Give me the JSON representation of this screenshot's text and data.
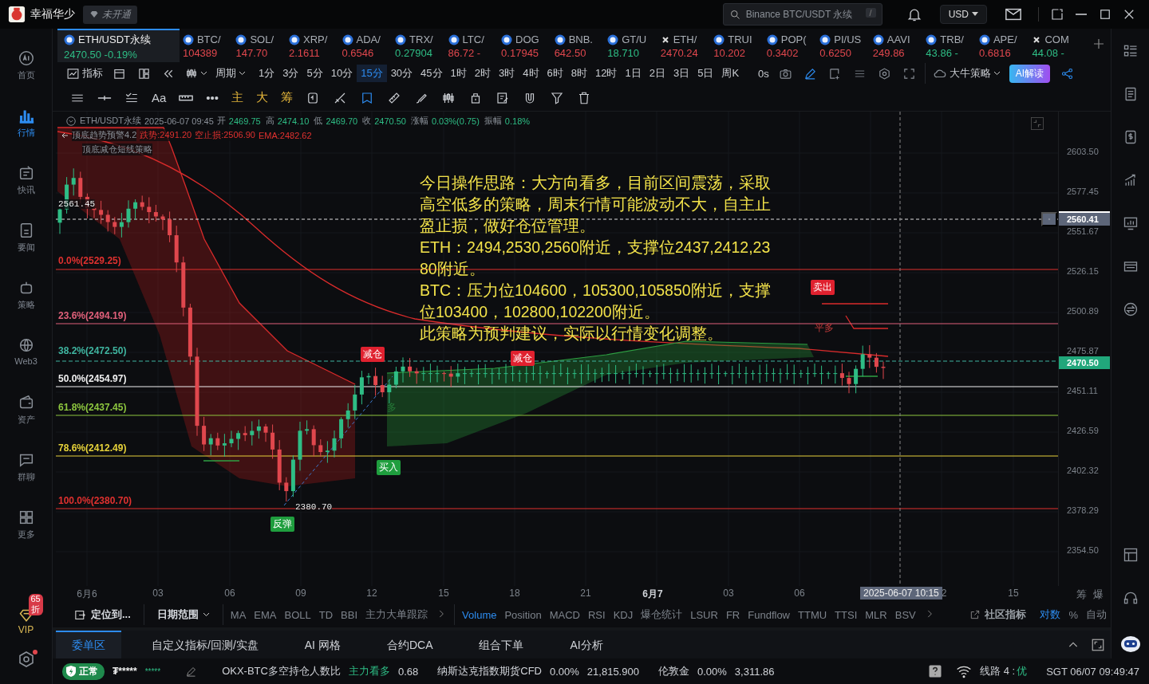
{
  "app": {
    "name": "幸福华少",
    "badge": "未开通"
  },
  "search": {
    "placeholder": "Binance BTC/USDT 永续",
    "shortcut": "/"
  },
  "currency": "USD",
  "sidebar": {
    "items": [
      {
        "label": "首页",
        "selected": false
      },
      {
        "label": "行情",
        "selected": true
      },
      {
        "label": "快讯",
        "selected": false
      },
      {
        "label": "要闻",
        "selected": false
      },
      {
        "label": "策略",
        "selected": false
      },
      {
        "label": "Web3",
        "selected": false
      },
      {
        "label": "资产",
        "selected": false
      },
      {
        "label": "群聊",
        "selected": false
      },
      {
        "label": "更多",
        "selected": false
      }
    ],
    "vip": {
      "label": "VIP",
      "badge": "65折"
    },
    "settings_alert": true
  },
  "tickers": [
    {
      "kind": "coin",
      "symbol": "ETH/USDT永续",
      "price": "2470.50 -0.19%",
      "rising": true,
      "selected": true
    },
    {
      "kind": "coin",
      "symbol": "BTC/",
      "price": "104389",
      "rising": false,
      "selected": false
    },
    {
      "kind": "coin",
      "symbol": "SOL/",
      "price": "147.70",
      "rising": false,
      "selected": false
    },
    {
      "kind": "coin",
      "symbol": "XRP/",
      "price": "2.1611",
      "rising": false,
      "selected": false
    },
    {
      "kind": "coin",
      "symbol": "ADA/",
      "price": "0.6546",
      "rising": false,
      "selected": false
    },
    {
      "kind": "coin",
      "symbol": "TRX/",
      "price": "0.27904",
      "rising": true,
      "selected": false
    },
    {
      "kind": "coin",
      "symbol": "LTC/",
      "price": "86.72 -",
      "rising": false,
      "selected": false
    },
    {
      "kind": "coin",
      "symbol": "DOG",
      "price": "0.17945",
      "rising": false,
      "selected": false
    },
    {
      "kind": "coin",
      "symbol": "BNB.",
      "price": "642.50",
      "rising": false,
      "selected": false
    },
    {
      "kind": "coin",
      "symbol": "GT/U",
      "price": "18.710",
      "rising": true,
      "selected": false
    },
    {
      "kind": "cross",
      "symbol": "ETH/",
      "price": "2470.24",
      "rising": false,
      "selected": false
    },
    {
      "kind": "coin",
      "symbol": "TRUI",
      "price": "10.202",
      "rising": false,
      "selected": false
    },
    {
      "kind": "coin",
      "symbol": "POP(",
      "price": "0.3402",
      "rising": false,
      "selected": false
    },
    {
      "kind": "coin",
      "symbol": "PI/US",
      "price": "0.6250",
      "rising": false,
      "selected": false
    },
    {
      "kind": "coin",
      "symbol": "AAVI",
      "price": "249.86",
      "rising": false,
      "selected": false
    },
    {
      "kind": "coin",
      "symbol": "TRB/",
      "price": "43.86 -",
      "rising": true,
      "selected": false
    },
    {
      "kind": "coin",
      "symbol": "APE/",
      "price": "0.6816",
      "rising": false,
      "selected": false
    },
    {
      "kind": "cross",
      "symbol": "COM",
      "price": "44.08 -",
      "rising": true,
      "selected": false
    }
  ],
  "toolbar": {
    "indicators": "指标",
    "period": "周期",
    "timeframes": [
      {
        "label": "1分",
        "selected": false
      },
      {
        "label": "3分",
        "selected": false
      },
      {
        "label": "5分",
        "selected": false
      },
      {
        "label": "10分",
        "selected": false
      },
      {
        "label": "15分",
        "selected": true
      },
      {
        "label": "30分",
        "selected": false
      },
      {
        "label": "45分",
        "selected": false
      },
      {
        "label": "1时",
        "selected": false
      },
      {
        "label": "2时",
        "selected": false
      },
      {
        "label": "3时",
        "selected": false
      },
      {
        "label": "4时",
        "selected": false
      },
      {
        "label": "6时",
        "selected": false
      },
      {
        "label": "8时",
        "selected": false
      },
      {
        "label": "12时",
        "selected": false
      },
      {
        "label": "1日",
        "selected": false
      },
      {
        "label": "2日",
        "selected": false
      },
      {
        "label": "3日",
        "selected": false
      },
      {
        "label": "5日",
        "selected": false
      },
      {
        "label": "周K",
        "selected": false
      }
    ],
    "countdown": "0s",
    "strategy": "大牛策略",
    "ai": "AI解读"
  },
  "draw_tools": {
    "text_tool": "Aa",
    "more": "•••",
    "overlays": [
      "主",
      "大",
      "筹"
    ]
  },
  "chart": {
    "header": {
      "symbol": "ETH/USDT永续",
      "time": "2025-06-07 09:45",
      "fields": [
        {
          "label": "开",
          "value": "2469.75"
        },
        {
          "label": "高",
          "value": "2474.10"
        },
        {
          "label": "低",
          "value": "2469.70"
        },
        {
          "label": "收",
          "value": "2470.50"
        },
        {
          "label": "涨幅",
          "value": "0.03%(0.75)"
        },
        {
          "label": "振幅",
          "value": "0.18%"
        }
      ]
    },
    "indicator": {
      "name": "顶底趋势预警4.2",
      "values": [
        "跌势:2491.20",
        "空止损:2506.90",
        "EMA:2482.62"
      ]
    },
    "strategy": "顶底减仓短线策略",
    "crosshair_price": "2561.45",
    "levels": [
      {
        "label": "0.0%(2529.25)",
        "color": "#e0312f"
      },
      {
        "label": "23.6%(2494.19)",
        "color": "#e0607a"
      },
      {
        "label": "38.2%(2472.50)",
        "color": "#3fb5a0"
      },
      {
        "label": "50.0%(2454.97)",
        "color": "#f0f0f0"
      },
      {
        "label": "61.8%(2437.45)",
        "color": "#8dc63f"
      },
      {
        "label": "78.6%(2412.49)",
        "color": "#e6d23a"
      },
      {
        "label": "100.0%(2380.70)",
        "color": "#e0312f"
      }
    ],
    "note": [
      "今日操作思路：大方向看多，目前区间震荡，采取高空低多的策略，周末行情可能波动不大，自主止盈止损，做好仓位管理。",
      "ETH：2494,2530,2560附近，支撑位2437,2412,2380附近。",
      "BTC：压力位104600，105300,105850附近，支撑位103400，102800,102200附近。",
      "此策略为预判建议，实际以行情变化调整。"
    ],
    "signals": [
      {
        "kind": "sell",
        "label": "减仓"
      },
      {
        "kind": "sell",
        "label": "减仓"
      },
      {
        "kind": "sell",
        "label": "卖出"
      },
      {
        "kind": "sell-text",
        "label": "平多"
      },
      {
        "kind": "buy-text",
        "label": "多"
      },
      {
        "kind": "buy",
        "label": "买入"
      },
      {
        "kind": "buy",
        "label": "反弹"
      }
    ],
    "low_label": "2380.70",
    "price_axis": [
      "2603.50",
      "2577.45",
      "2551.67",
      "2526.15",
      "2500.89",
      "2475.87",
      "2451.11",
      "2426.59",
      "2402.32",
      "2378.29",
      "2354.50"
    ],
    "crosshair_axis_price": "2560.41",
    "last_price": "2470.50",
    "time_axis": [
      {
        "label": "6月6",
        "major": false
      },
      {
        "label": "03",
        "major": false
      },
      {
        "label": "06",
        "major": false
      },
      {
        "label": "09",
        "major": false
      },
      {
        "label": "12",
        "major": false
      },
      {
        "label": "15",
        "major": false
      },
      {
        "label": "18",
        "major": false
      },
      {
        "label": "21",
        "major": false
      },
      {
        "label": "6月7",
        "major": true
      },
      {
        "label": "03",
        "major": false
      },
      {
        "label": "06",
        "major": false
      },
      {
        "label": "2",
        "major": false
      },
      {
        "label": "15",
        "major": false
      }
    ],
    "crosshair_time": "2025-06-07 10:15",
    "axis_marks": [
      "筹",
      "爆"
    ]
  },
  "indicator_bar": {
    "locate": "定位到...",
    "date_range": "日期范围",
    "main": [
      {
        "label": "MA",
        "selected": false
      },
      {
        "label": "EMA",
        "selected": false
      },
      {
        "label": "BOLL",
        "selected": false
      },
      {
        "label": "TD",
        "selected": false
      },
      {
        "label": "BBI",
        "selected": false
      },
      {
        "label": "主力大单跟踪",
        "selected": false
      }
    ],
    "sub": [
      {
        "label": "Volume",
        "selected": true
      },
      {
        "label": "Position",
        "selected": false
      },
      {
        "label": "MACD",
        "selected": false
      },
      {
        "label": "RSI",
        "selected": false
      },
      {
        "label": "KDJ",
        "selected": false
      },
      {
        "label": "爆仓统计",
        "selected": false
      },
      {
        "label": "LSUR",
        "selected": false
      },
      {
        "label": "FR",
        "selected": false
      },
      {
        "label": "Fundflow",
        "selected": false
      },
      {
        "label": "TTMU",
        "selected": false
      },
      {
        "label": "TTSI",
        "selected": false
      },
      {
        "label": "MLR",
        "selected": false
      },
      {
        "label": "BSV",
        "selected": false
      }
    ],
    "community": "社区指标",
    "scales": [
      {
        "label": "对数",
        "selected": true
      },
      {
        "label": "%",
        "selected": false
      },
      {
        "label": "自动",
        "selected": false
      }
    ]
  },
  "bottom_tabs": [
    {
      "label": "委单区",
      "selected": true
    },
    {
      "label": "自定义指标/回测/实盘",
      "selected": false
    },
    {
      "label": "AI 网格",
      "selected": false
    },
    {
      "label": "合约DCA",
      "selected": false
    },
    {
      "label": "组合下单",
      "selected": false
    },
    {
      "label": "AI分析",
      "selected": false
    }
  ],
  "status_bar": {
    "connection": "正常",
    "account": "₮*****",
    "balance": "*****",
    "items": [
      {
        "kind": "label",
        "text": "OKX-BTC多空持仓人数比"
      },
      {
        "kind": "up",
        "text": "主力看多"
      },
      {
        "kind": "value",
        "text": "0.68"
      },
      {
        "kind": "label",
        "text": "纳斯达克指数期货CFD"
      },
      {
        "kind": "value",
        "text": "0.00%"
      },
      {
        "kind": "value",
        "text": "21,815.900"
      },
      {
        "kind": "label",
        "text": "伦敦金"
      },
      {
        "kind": "value",
        "text": "0.00%"
      },
      {
        "kind": "value",
        "text": "3,311.86"
      }
    ],
    "line": "线路 4 :",
    "quality": "优",
    "clock": "SGT 06/07 09:49:47"
  }
}
